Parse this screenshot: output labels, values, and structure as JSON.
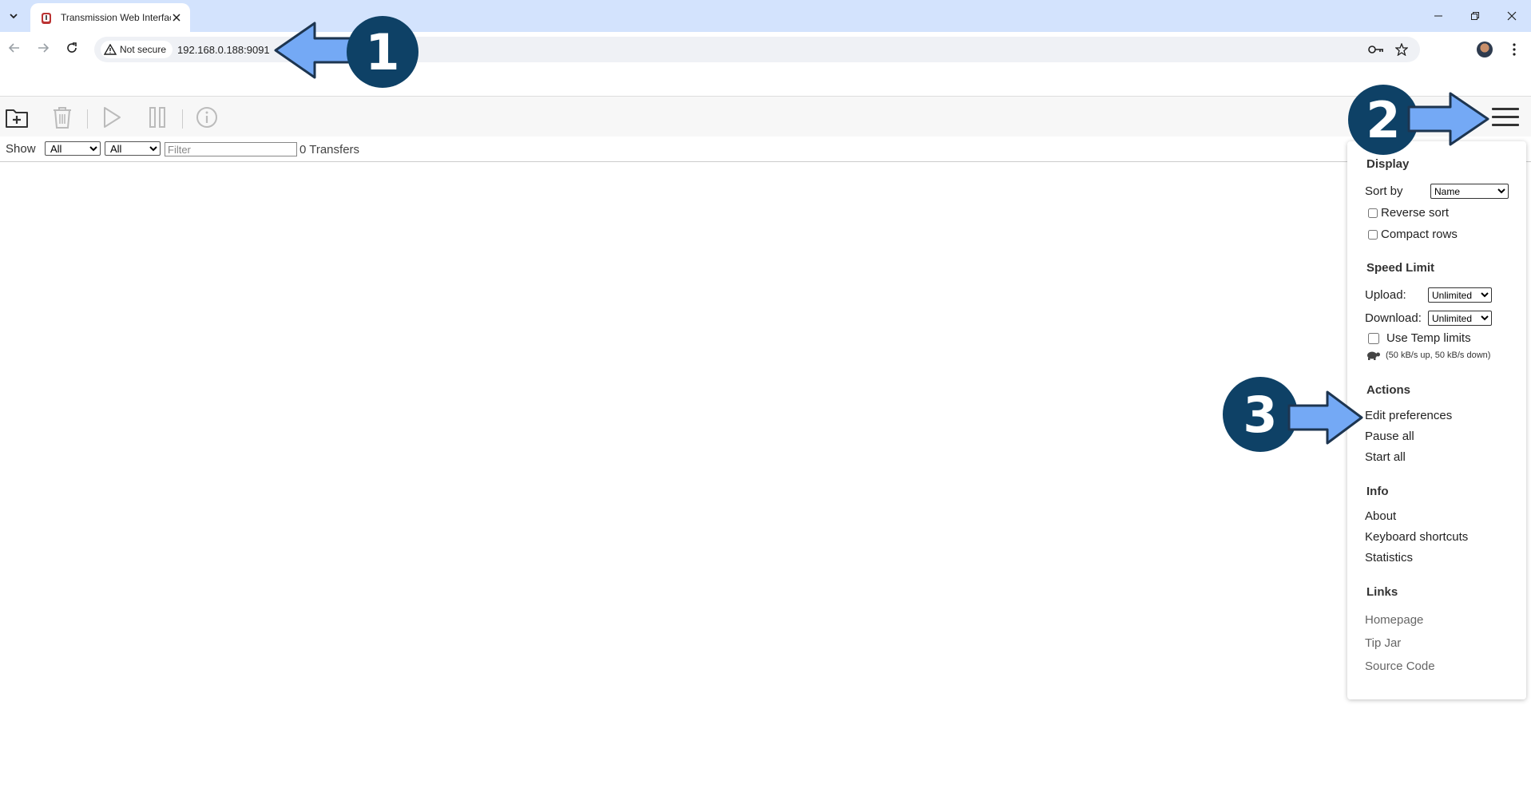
{
  "browser": {
    "tab_title": "Transmission Web Interface",
    "security_label": "Not secure",
    "url": "192.168.0.188:9091"
  },
  "filterbar": {
    "show_label": "Show",
    "status_filter": "All",
    "tracker_filter": "All",
    "filter_placeholder": "Filter",
    "transfers_count": "0 Transfers"
  },
  "menu": {
    "display": {
      "header": "Display",
      "sort_by_label": "Sort by",
      "sort_by_value": "Name",
      "reverse_sort": "Reverse sort",
      "compact_rows": "Compact rows"
    },
    "speed_limit": {
      "header": "Speed Limit",
      "upload_label": "Upload:",
      "upload_value": "Unlimited",
      "download_label": "Download:",
      "download_value": "Unlimited",
      "use_temp_limits": "Use Temp limits",
      "temp_limits_info": "(50 kB/s up, 50 kB/s down)"
    },
    "actions": {
      "header": "Actions",
      "edit_preferences": "Edit preferences",
      "pause_all": "Pause all",
      "start_all": "Start all"
    },
    "info": {
      "header": "Info",
      "about": "About",
      "keyboard_shortcuts": "Keyboard shortcuts",
      "statistics": "Statistics"
    },
    "links": {
      "header": "Links",
      "homepage": "Homepage",
      "tip_jar": "Tip Jar",
      "source_code": "Source Code"
    }
  },
  "annotations": {
    "step1": "1",
    "step2": "2",
    "step3": "3",
    "callout_color": "#0e4166",
    "arrow_color": "#74a9f5"
  }
}
